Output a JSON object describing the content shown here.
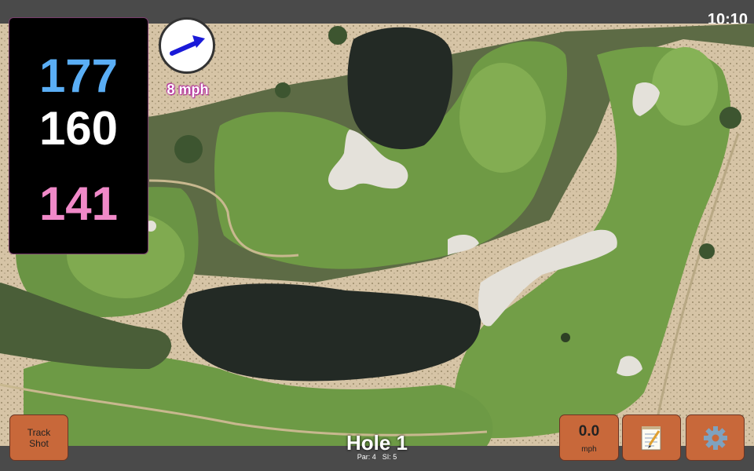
{
  "status": {
    "time": "10:10"
  },
  "yardages": {
    "back": "177",
    "center": "160",
    "front": "141"
  },
  "wind": {
    "speed": "8 mph",
    "arrow_icon": "arrow-right-icon"
  },
  "hole": {
    "title": "Hole 1",
    "par": "Par: 4",
    "stroke_index": "SI: 5"
  },
  "buttons": {
    "track_shot": {
      "line1": "Track",
      "line2": "Shot"
    },
    "speed": {
      "value": "0.0",
      "unit": "mph"
    },
    "notes_icon": "notepad-icon",
    "settings_icon": "gear-icon"
  },
  "colors": {
    "back": "#5aaef5",
    "center": "#ffffff",
    "front": "#f089c8",
    "button": "#c8683a",
    "wind_text_outline": "#b3279e"
  }
}
